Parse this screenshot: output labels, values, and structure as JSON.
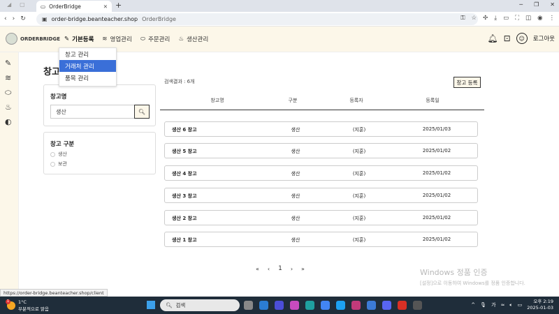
{
  "browser": {
    "tab_title": "OrderBridge",
    "url_host": "order-bridge.beanteacher.shop",
    "url_title": "OrderBridge",
    "status_url": "https://order-bridge.beanteacher.shop/client"
  },
  "app": {
    "logo": "ORDERBRIDGE",
    "nav": [
      {
        "label": "기본등록",
        "icon": "edit-icon"
      },
      {
        "label": "영업관리",
        "icon": "layers-icon"
      },
      {
        "label": "주문관리",
        "icon": "pill-icon"
      },
      {
        "label": "생산관리",
        "icon": "pot-icon"
      }
    ],
    "logout": "로그아웃",
    "dropdown": [
      "창고 관리",
      "거래처 관리",
      "품목 관리"
    ]
  },
  "page": {
    "title": "창고",
    "filter_name": {
      "heading": "창고명",
      "value": "생산",
      "search_icon": "search-icon"
    },
    "filter_type": {
      "heading": "창고 구분",
      "options": [
        "생산",
        "보관"
      ]
    },
    "result_count": "검색결과 : 6개",
    "add_button": "창고 등록",
    "columns": [
      "창고명",
      "구분",
      "등록자",
      "등록일"
    ],
    "rows": [
      {
        "name": "생산 6 창고",
        "type": "생산",
        "registrant": "(지훈)",
        "date": "2025/01/03"
      },
      {
        "name": "생산 5 창고",
        "type": "생산",
        "registrant": "(지훈)",
        "date": "2025/01/02"
      },
      {
        "name": "생산 4 창고",
        "type": "생산",
        "registrant": "(지훈)",
        "date": "2025/01/02"
      },
      {
        "name": "생산 3 창고",
        "type": "생산",
        "registrant": "(지훈)",
        "date": "2025/01/02"
      },
      {
        "name": "생산 2 창고",
        "type": "생산",
        "registrant": "(지훈)",
        "date": "2025/01/02"
      },
      {
        "name": "생산 1 창고",
        "type": "생산",
        "registrant": "(지훈)",
        "date": "2025/01/02"
      }
    ],
    "pager": {
      "first": "«",
      "prev": "‹",
      "current": "1",
      "next": "›",
      "last": "»"
    }
  },
  "watermark": {
    "line1": "Windows 정품 인증",
    "line2": "[설정]으로 이동하여 Windows를 정품 인증합니다."
  },
  "taskbar": {
    "weather_temp": "1°C",
    "weather_desc": "부분적으로 맑음",
    "weather_badge": "1",
    "search": "검색",
    "ime": "가",
    "time": "오후 2:19",
    "date": "2025-01-03"
  },
  "colors": {
    "header_bg": "#fcf7e9",
    "dropdown_highlight": "#3a6fd8",
    "taskbar_bg": "#1f2d3a"
  }
}
